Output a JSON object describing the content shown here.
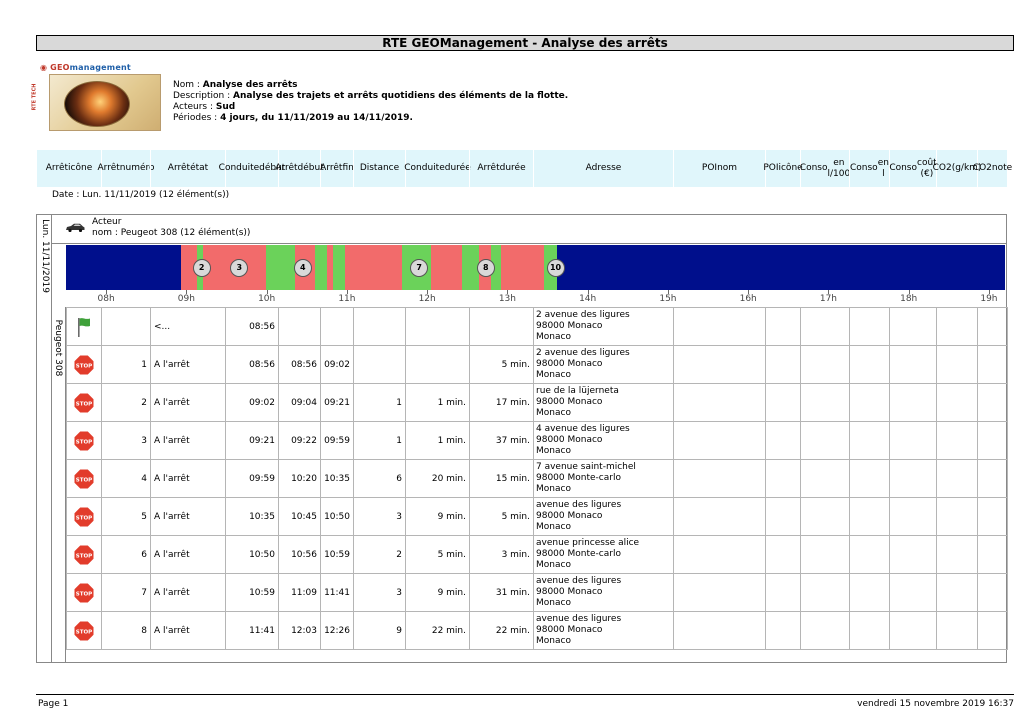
{
  "report_title": "RTE GEOManagement - Analyse des arrêts",
  "logo": {
    "word_a": "GEO",
    "word_b": "management",
    "side": "RTE TECH"
  },
  "info": {
    "nom_label": "Nom :",
    "nom": "Analyse des arrêts",
    "desc_label": "Description :",
    "desc": "Analyse des trajets et arrêts quotidiens des éléments de la flotte.",
    "acteurs_label": "Acteurs :",
    "acteurs": "Sud",
    "periodes_label": "Périodes :",
    "periodes": "4 jours, du 11/11/2019 au 14/11/2019."
  },
  "columns": [
    [
      "Arrêt",
      "icône"
    ],
    [
      "Arrêt",
      "numéro"
    ],
    [
      "Arrêt",
      "état"
    ],
    [
      "Conduite",
      "début"
    ],
    [
      "Arrêt",
      "début"
    ],
    [
      "Arrêt",
      "fin"
    ],
    [
      "Distance"
    ],
    [
      "Conduite",
      "durée"
    ],
    [
      "Arrêt",
      "durée"
    ],
    [
      "Adresse"
    ],
    [
      "POI",
      "nom"
    ],
    [
      "POI",
      "icône"
    ],
    [
      "Conso",
      "en l/100"
    ],
    [
      "Conso",
      "en l"
    ],
    [
      "Conso",
      "coût (€)"
    ],
    [
      "CO2",
      "(g/km)"
    ],
    [
      "CO2",
      "note"
    ]
  ],
  "date_line": "Date : Lun. 11/11/2019 (12 élément(s))",
  "group_vertical_label": "Lun. 11/11/2019",
  "actor": {
    "label": "Acteur",
    "name_line": "nom : Peugeot 308 (12 élément(s))"
  },
  "vehicle_vertical_label": "Peugeot 308",
  "timeline": {
    "start_hour": 7.5,
    "end_hour": 19.2,
    "hour_ticks": [
      "08h",
      "09h",
      "10h",
      "11h",
      "12h",
      "13h",
      "14h",
      "15h",
      "16h",
      "17h",
      "18h",
      "19h"
    ],
    "segments": [
      {
        "from": 8.93,
        "to": 9.13,
        "color": "#f26b6b"
      },
      {
        "from": 9.13,
        "to": 9.21,
        "color": "#6bd25a"
      },
      {
        "from": 9.21,
        "to": 9.99,
        "color": "#f26b6b"
      },
      {
        "from": 9.99,
        "to": 10.35,
        "color": "#6bd25a"
      },
      {
        "from": 10.35,
        "to": 10.6,
        "color": "#f26b6b"
      },
      {
        "from": 10.6,
        "to": 10.75,
        "color": "#6bd25a"
      },
      {
        "from": 10.75,
        "to": 10.83,
        "color": "#f26b6b"
      },
      {
        "from": 10.83,
        "to": 10.98,
        "color": "#6bd25a"
      },
      {
        "from": 10.98,
        "to": 11.15,
        "color": "#f26b6b"
      },
      {
        "from": 11.15,
        "to": 11.69,
        "color": "#f26b6b"
      },
      {
        "from": 11.69,
        "to": 12.05,
        "color": "#6bd25a"
      },
      {
        "from": 12.05,
        "to": 12.44,
        "color": "#f26b6b"
      },
      {
        "from": 12.44,
        "to": 12.65,
        "color": "#6bd25a"
      },
      {
        "from": 12.65,
        "to": 12.8,
        "color": "#f26b6b"
      },
      {
        "from": 12.8,
        "to": 12.92,
        "color": "#6bd25a"
      },
      {
        "from": 12.92,
        "to": 13.45,
        "color": "#f26b6b"
      },
      {
        "from": 13.45,
        "to": 13.62,
        "color": "#6bd25a"
      }
    ],
    "markers": [
      {
        "label": "2",
        "hour": 9.19
      },
      {
        "label": "3",
        "hour": 9.66
      },
      {
        "label": "4",
        "hour": 10.45
      },
      {
        "label": "7",
        "hour": 11.9
      },
      {
        "label": "8",
        "hour": 12.73
      },
      {
        "label": "10",
        "hour": 13.6
      }
    ]
  },
  "rows": [
    {
      "icon": "flag",
      "num": "",
      "etat": "<...",
      "cd": "08:56",
      "ad": "",
      "af": "",
      "dist": "",
      "cdur": "",
      "adur": "",
      "addr": [
        "2 avenue des ligures",
        "98000 Monaco",
        "Monaco"
      ]
    },
    {
      "icon": "stop",
      "num": "1",
      "etat": "A l'arrêt",
      "cd": "08:56",
      "ad": "08:56",
      "af": "09:02",
      "dist": "",
      "cdur": "",
      "adur": "5 min.",
      "addr": [
        "2 avenue des ligures",
        "98000 Monaco",
        "Monaco"
      ]
    },
    {
      "icon": "stop",
      "num": "2",
      "etat": "A l'arrêt",
      "cd": "09:02",
      "ad": "09:04",
      "af": "09:21",
      "dist": "1",
      "cdur": "1 min.",
      "adur": "17 min.",
      "addr": [
        "rue de la lüjerneta",
        "98000 Monaco",
        "Monaco"
      ]
    },
    {
      "icon": "stop",
      "num": "3",
      "etat": "A l'arrêt",
      "cd": "09:21",
      "ad": "09:22",
      "af": "09:59",
      "dist": "1",
      "cdur": "1 min.",
      "adur": "37 min.",
      "addr": [
        "4 avenue des ligures",
        "98000 Monaco",
        "Monaco"
      ]
    },
    {
      "icon": "stop",
      "num": "4",
      "etat": "A l'arrêt",
      "cd": "09:59",
      "ad": "10:20",
      "af": "10:35",
      "dist": "6",
      "cdur": "20 min.",
      "adur": "15 min.",
      "addr": [
        "7 avenue saint-michel",
        "98000 Monte-carlo",
        "Monaco"
      ]
    },
    {
      "icon": "stop",
      "num": "5",
      "etat": "A l'arrêt",
      "cd": "10:35",
      "ad": "10:45",
      "af": "10:50",
      "dist": "3",
      "cdur": "9 min.",
      "adur": "5 min.",
      "addr": [
        "avenue des ligures",
        "98000 Monaco",
        "Monaco"
      ]
    },
    {
      "icon": "stop",
      "num": "6",
      "etat": "A l'arrêt",
      "cd": "10:50",
      "ad": "10:56",
      "af": "10:59",
      "dist": "2",
      "cdur": "5 min.",
      "adur": "3 min.",
      "addr": [
        "avenue princesse alice",
        "98000 Monte-carlo",
        "Monaco"
      ]
    },
    {
      "icon": "stop",
      "num": "7",
      "etat": "A l'arrêt",
      "cd": "10:59",
      "ad": "11:09",
      "af": "11:41",
      "dist": "3",
      "cdur": "9 min.",
      "adur": "31 min.",
      "addr": [
        "avenue des ligures",
        "98000 Monaco",
        "Monaco"
      ]
    },
    {
      "icon": "stop",
      "num": "8",
      "etat": "A l'arrêt",
      "cd": "11:41",
      "ad": "12:03",
      "af": "12:26",
      "dist": "9",
      "cdur": "22 min.",
      "adur": "22 min.",
      "addr": [
        "avenue des ligures",
        "98000 Monaco",
        "Monaco"
      ]
    }
  ],
  "footer": {
    "page": "Page 1",
    "printed": "vendredi 15 novembre 2019 16:37"
  },
  "colors": {
    "header_bg": "#e0f6fb",
    "timeline_bg": "#000f8c",
    "drive": "#f26b6b",
    "stop": "#6bd25a"
  }
}
